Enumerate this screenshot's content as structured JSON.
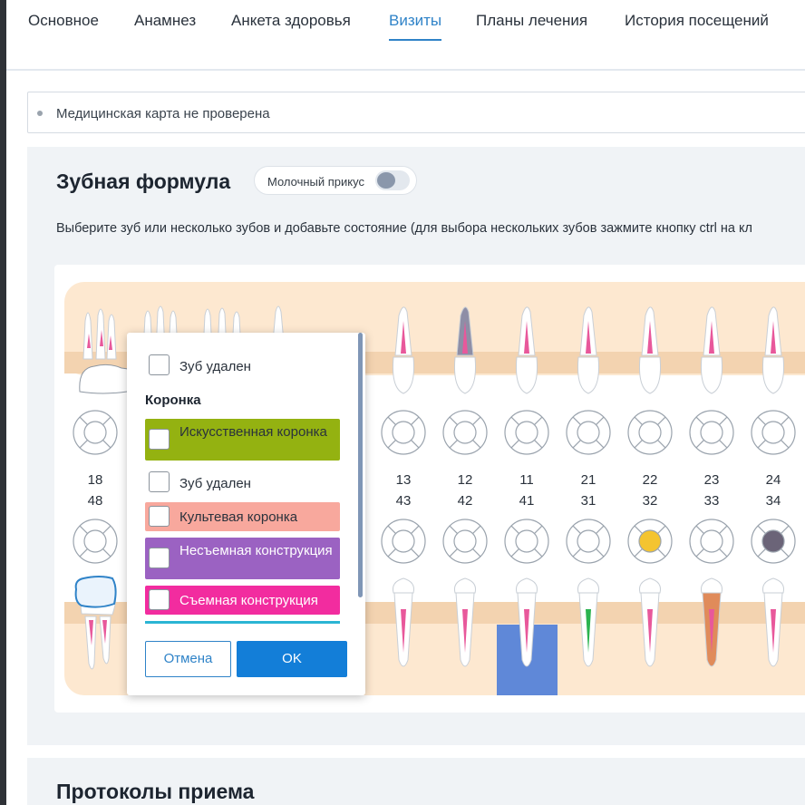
{
  "tabs": [
    {
      "label": "Основное",
      "active": false
    },
    {
      "label": "Анамнез",
      "active": false
    },
    {
      "label": "Анкета здоровья",
      "active": false
    },
    {
      "label": "Визиты",
      "active": true
    },
    {
      "label": "Планы лечения",
      "active": false
    },
    {
      "label": "История посещений",
      "active": false
    }
  ],
  "notice": {
    "text": "Медицинская карта не проверена"
  },
  "dental_formula": {
    "title": "Зубная формула",
    "milk_bite_label": "Молочный прикус",
    "milk_bite_on": false,
    "hint": "Выберите зуб или несколько зубов и добавьте состояние (для выбора нескольких зубов зажмите кнопку ctrl на кл",
    "upper_numbers": [
      "18",
      "13",
      "12",
      "11",
      "21",
      "22",
      "23",
      "24"
    ],
    "lower_numbers": [
      "48",
      "43",
      "42",
      "41",
      "31",
      "32",
      "33",
      "34"
    ],
    "colors": {
      "gum": "#fde8d0",
      "band": "#f3d3b0",
      "pulp": "#e8589b",
      "yellow": "#f4c430",
      "purple_gray": "#6b6478",
      "olive": "#97ad2c",
      "blue": "#5f88d8",
      "green": "#2bb34f",
      "orange": "#e08b5a",
      "gray_tooth": "#aab0c0",
      "dark_tooth": "#8e8ea6"
    }
  },
  "popup": {
    "top_option": "Зуб удален",
    "group_label": "Коронка",
    "options": [
      {
        "label": "Искусственная коронка",
        "color": "#94b211"
      },
      {
        "label": "Зуб удален",
        "color": ""
      },
      {
        "label": "Культевая коронка",
        "color": "#f8a89d"
      },
      {
        "label": "Несъемная конструкция",
        "color": "#9b62c2"
      },
      {
        "label": "Съемная конструкция",
        "color": "#f22c9f"
      }
    ],
    "cancel_label": "Отмена",
    "ok_label": "OK"
  },
  "protocols": {
    "title": "Протоколы приема"
  }
}
